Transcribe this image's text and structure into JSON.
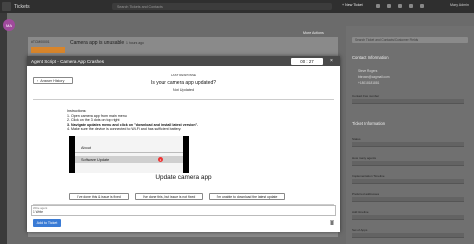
{
  "app": {
    "title": "Tickets",
    "user_initials": "MA"
  },
  "topbar": {
    "search_placeholder": "Search Tickets and Contacts",
    "new_ticket_label": "+ New Ticket",
    "user_name": "Mary Admin"
  },
  "ticket": {
    "id": "#TCM00001",
    "subject": "Camera app is unusable",
    "meta": "1 hours ago"
  },
  "toolbar": {
    "more_actions_label": "More Actions"
  },
  "right_panel": {
    "search_placeholder": "Search Ticket and Contacts/Customer Fields",
    "contact_heading": "Contact Information",
    "contact_lines": [
      "Steve Rogers",
      "bbrown@cagmail.com",
      "+18018181881"
    ],
    "contact_field_label": "Contact Fax number",
    "ticket_heading": "Ticket Information",
    "ticket_fields": [
      "Status",
      "How many agents",
      "Implementation Timeline",
      "Preferred addresses",
      "Add timeline",
      "Set of Apps"
    ]
  },
  "modal": {
    "title": "Agent Script - Camera App Crashes",
    "timer": "00 : 27",
    "answer_history_label": "Answer History",
    "last_response_label": "LAST RESPONSE",
    "question": "Is your camera app updated?",
    "answer": "Not Updated",
    "instructions_heading": "Instructions:",
    "instructions": [
      "1. Open camera app from main menu",
      "2. Click on the 3 dots on top right",
      "3. Navigate updates menu and click on \"download and install latest version\".",
      "4. Make sure the device is connected to Wi-Fi and has sufficient battery."
    ],
    "phone_menu": {
      "row1": "About",
      "row2": "Software Update",
      "badge": "1"
    },
    "image_caption": "Update camera app",
    "choices": [
      "I've done this & issue is fixed",
      "I've done this, but issue is not fixed",
      "I'm unable to download the latest update"
    ],
    "notes_label": "Write agent",
    "notes_value": "1 Write",
    "add_to_ticket_label": "Add to Ticket"
  }
}
